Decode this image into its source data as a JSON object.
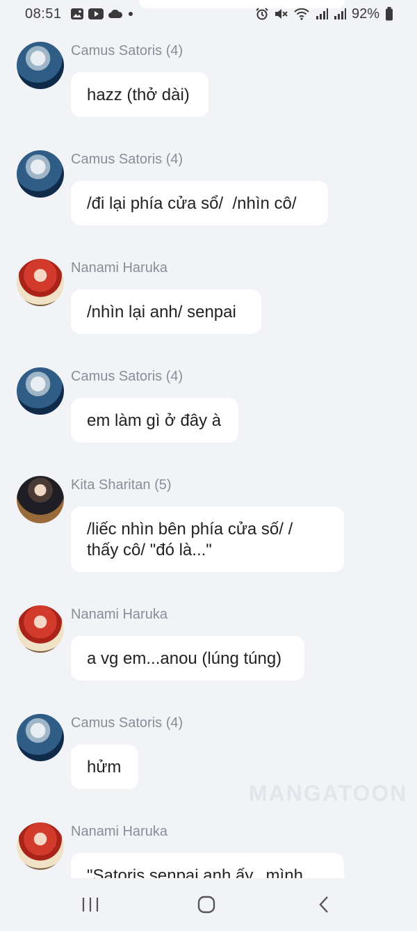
{
  "status_bar": {
    "time": "08:51",
    "battery": "92%",
    "left_icons": [
      "gallery-icon",
      "youtube-icon",
      "cloud-icon",
      "dot-icon"
    ],
    "right_icons": [
      "alarm-icon",
      "mute-icon",
      "wifi-icon",
      "signal-icon",
      "signal-icon",
      "battery-icon"
    ]
  },
  "messages": [
    {
      "name": "Camus Satoris (4)",
      "text": "hazz (thở dài)",
      "avatar": "camus"
    },
    {
      "name": "Camus Satoris (4)",
      "text": "/đi lại phía cửa sổ/  /nhìn cô/",
      "avatar": "camus"
    },
    {
      "name": "Nanami Haruka",
      "text": "/nhìn lại anh/ senpai",
      "avatar": "nanami"
    },
    {
      "name": "Camus Satoris (4)",
      "text": "em làm gì ở đây à",
      "avatar": "camus"
    },
    {
      "name": "Kita Sharitan (5)",
      "text": "/liếc nhìn bên phía cửa số/ /\nthấy cô/ \"đó là...\"",
      "avatar": "kita"
    },
    {
      "name": "Nanami Haruka",
      "text": "a vg em...anou (lúng túng)",
      "avatar": "nanami"
    },
    {
      "name": "Camus Satoris (4)",
      "text": "hửm",
      "avatar": "camus"
    },
    {
      "name": "Nanami Haruka",
      "text": "\"Satoris senpai anh ấy...mình",
      "avatar": "nanami"
    }
  ],
  "watermark": "MANGATOON",
  "nav": {
    "recents": "recent-apps-icon",
    "home": "home-icon",
    "back": "back-icon"
  }
}
